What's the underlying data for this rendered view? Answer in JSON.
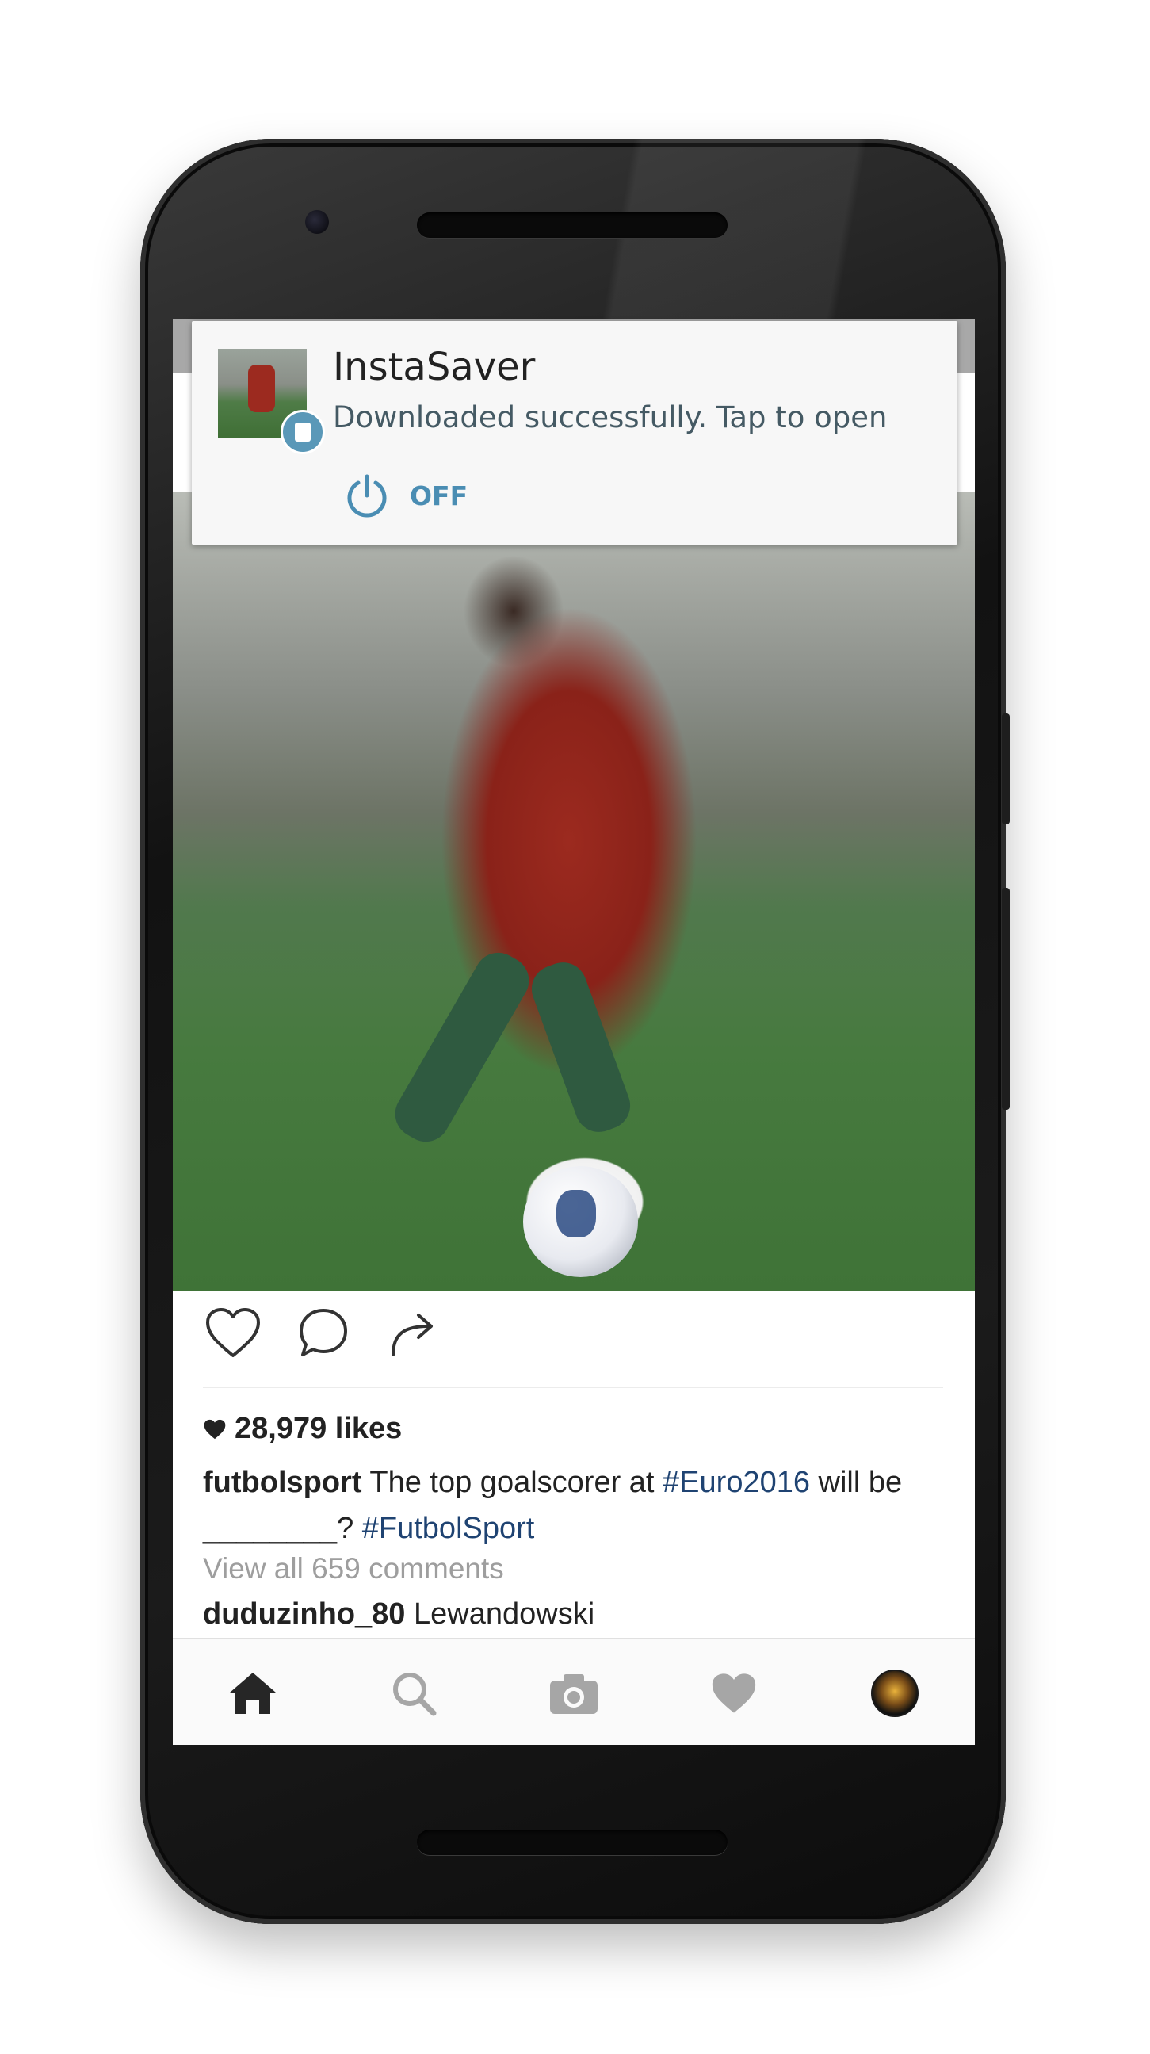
{
  "notification": {
    "app_name": "InstaSaver",
    "message": "Downloaded successfully. Tap to open",
    "action_label": "OFF",
    "accent_color": "#4a8db3",
    "icons": {
      "thumbnail": "post-thumbnail",
      "badge": "instasaver-badge-icon",
      "action": "power-icon"
    }
  },
  "post": {
    "likes_text": "28,979 likes",
    "caption": {
      "username": "futbolsport",
      "text_before": " The top goalscorer at ",
      "hashtag1": "#Euro2016",
      "text_middle": " will be ________? ",
      "hashtag2": "#FutbolSport"
    },
    "view_comments": "View all 659 comments",
    "comment": {
      "username": "duduzinho_80",
      "text": " Lewandowski"
    },
    "action_icons": [
      "heart-outline-icon",
      "comment-icon",
      "share-icon"
    ]
  },
  "tabbar": {
    "tabs": [
      "home-icon",
      "search-icon",
      "camera-icon",
      "activity-heart-icon",
      "profile-avatar"
    ],
    "active": "home-icon"
  },
  "colors": {
    "hashtag": "#1f4372",
    "secondary_text": "#9e9e9e"
  }
}
